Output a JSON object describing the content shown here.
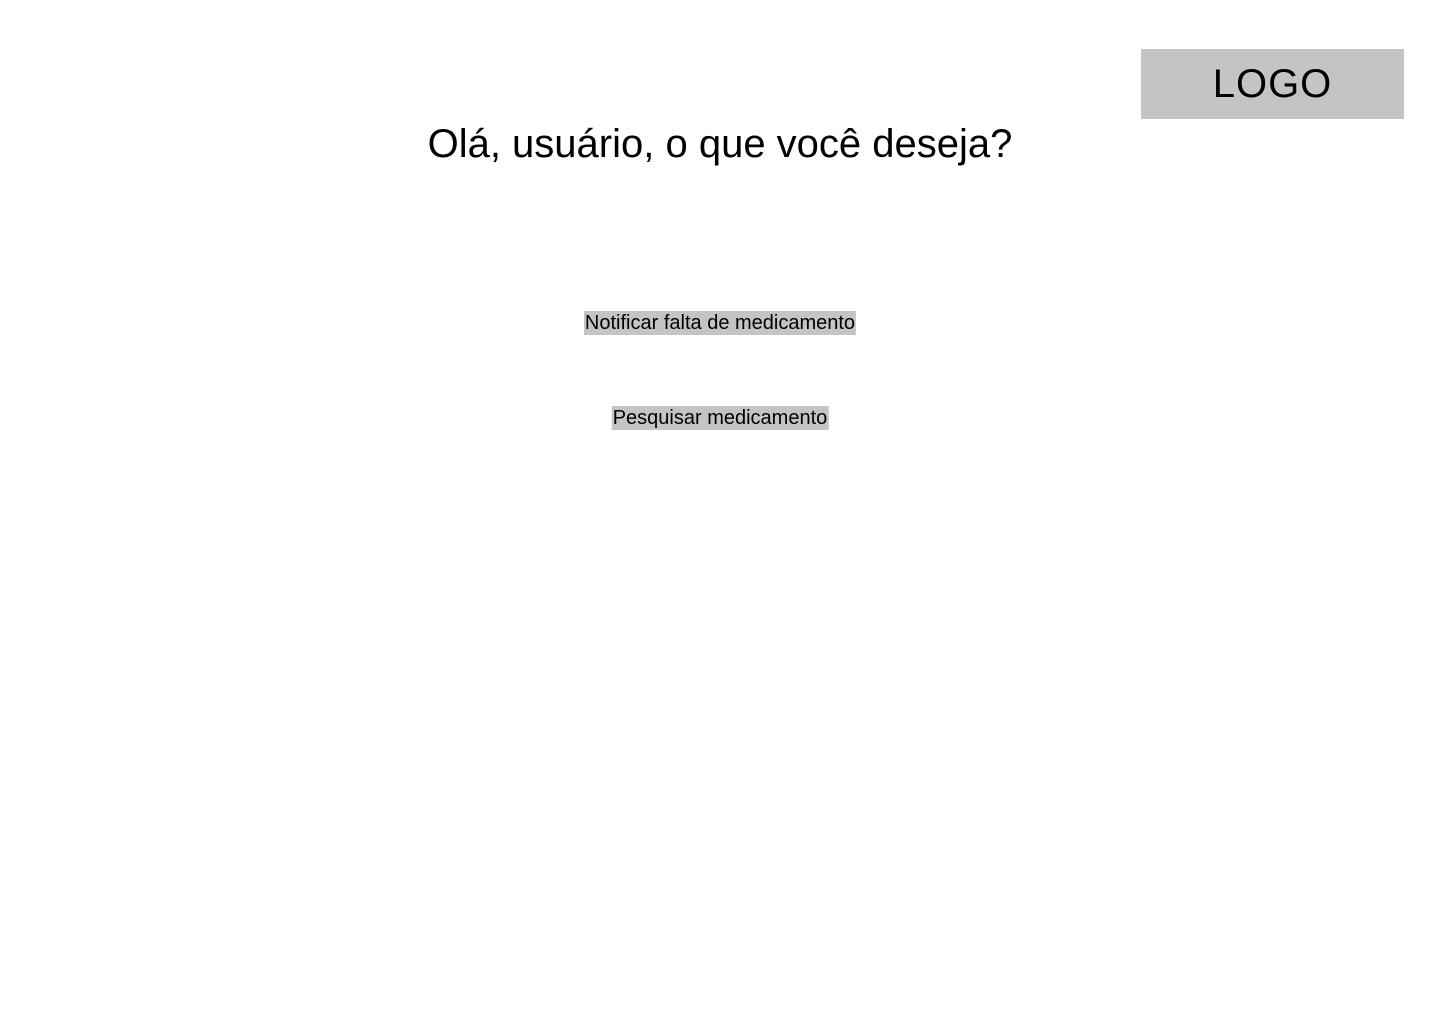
{
  "header": {
    "logo_text": "LOGO",
    "greeting": "Olá, usuário, o que você deseja?"
  },
  "actions": {
    "notify_label": "Notificar falta de medicamento",
    "search_label": "Pesquisar medicamento"
  },
  "colors": {
    "background": "#ffffff",
    "placeholder_gray": "#c4c4c4",
    "text": "#000000"
  }
}
